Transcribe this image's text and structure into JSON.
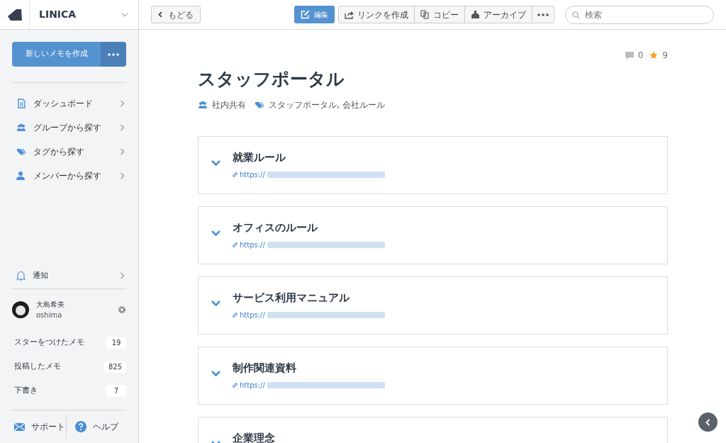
{
  "app": {
    "name": "LINICA"
  },
  "sidebar": {
    "new_button": "新しいメモを作成",
    "nav": [
      {
        "label": "ダッシュボード",
        "kind": "doc"
      },
      {
        "label": "グループから探す",
        "kind": "group"
      },
      {
        "label": "タグから探す",
        "kind": "tag"
      },
      {
        "label": "メンバーから探す",
        "kind": "member"
      }
    ],
    "notifications": "通知",
    "user": {
      "name": "大島希美",
      "id": "oshima"
    },
    "counts": [
      {
        "label": "スターをつけたメモ",
        "count": "19"
      },
      {
        "label": "投稿したメモ",
        "count": "825"
      },
      {
        "label": "下書き",
        "count": "7"
      }
    ],
    "footer": [
      {
        "label": "サポート",
        "kind": "mail"
      },
      {
        "label": "ヘルプ",
        "kind": "help"
      }
    ]
  },
  "toolbar": {
    "back": "もどる",
    "actions": [
      {
        "label": "編集",
        "kind": "edit",
        "primary": true
      },
      {
        "label": "リンクを作成",
        "kind": "share",
        "primary": false
      },
      {
        "label": "コピー",
        "kind": "copy",
        "primary": false
      },
      {
        "label": "アーカイブ",
        "kind": "archive",
        "primary": false
      }
    ],
    "search": {
      "placeholder": "検索"
    }
  },
  "memo": {
    "comments": "0",
    "stars": "9",
    "title": "スタッフポータル",
    "group": "社内共有",
    "tags": "スタッフポータル, 会社ルール",
    "sections": [
      {
        "title": "就業ルール",
        "link": "https://",
        "expanded": false
      },
      {
        "title": "オフィスのルール",
        "link": "https://",
        "expanded": false
      },
      {
        "title": "サービス利用マニュアル",
        "link": "https://",
        "expanded": false
      },
      {
        "title": "制作関連資料",
        "link": "https://",
        "expanded": false
      },
      {
        "title": "企業理念",
        "expanded": false
      }
    ]
  }
}
